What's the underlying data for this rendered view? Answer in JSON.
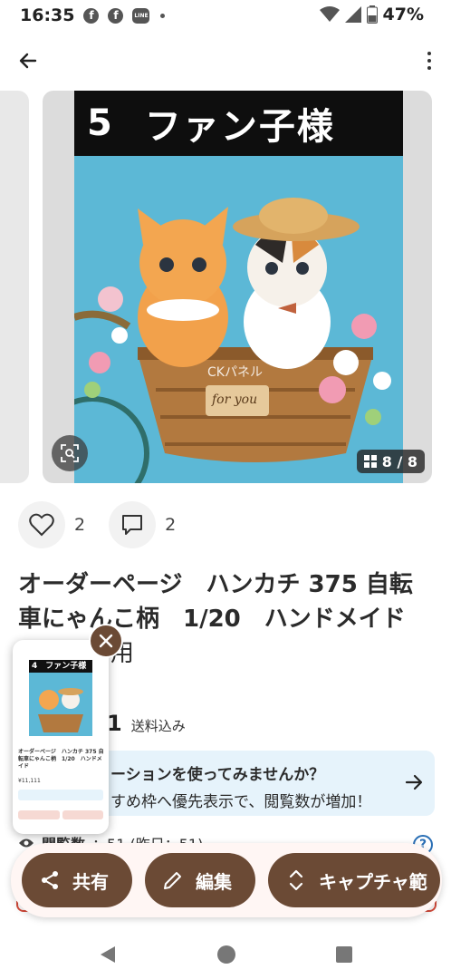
{
  "status_bar": {
    "time": "16:35",
    "battery": "47%",
    "notification_icons": [
      "facebook-icon",
      "facebook-icon",
      "line-icon"
    ],
    "line_label": "LINE"
  },
  "carousel": {
    "banner_number": "5",
    "banner_text": "ファン子様",
    "watermark": "CKパネル",
    "sign_text": "for you",
    "counter": "8 / 8",
    "prev_counter": "8"
  },
  "reactions": {
    "likes": "2",
    "comments": "2"
  },
  "product": {
    "title_line1": "オーダーページ　ハンカチ 375 自転",
    "title_line2": "車にゃんこ柄　1/20　ハンドメイド",
    "title_line3": "用",
    "price_fragment": "1",
    "shipping": "送料込み"
  },
  "promo": {
    "line1": "ーションを使ってみませんか？",
    "line2": "すめ枠へ優先表示で、閲覧数が増加！"
  },
  "views": {
    "label": "閲覧数",
    "value": "：51 (昨日：51)"
  },
  "actions": {
    "share": "共有",
    "edit": "編集",
    "capture": "キャプチャ範"
  },
  "thumbnail": {
    "banner": "4　ファン子様",
    "title": "オーダーページ　ハンカチ 375 自転車にゃんこ柄　1/20　ハンドメイド",
    "price": "¥11,111"
  },
  "colors": {
    "accent_brown": "#6b4a35",
    "promo_bg": "#e6f3fb",
    "photo_sky": "#5cb8d6"
  }
}
